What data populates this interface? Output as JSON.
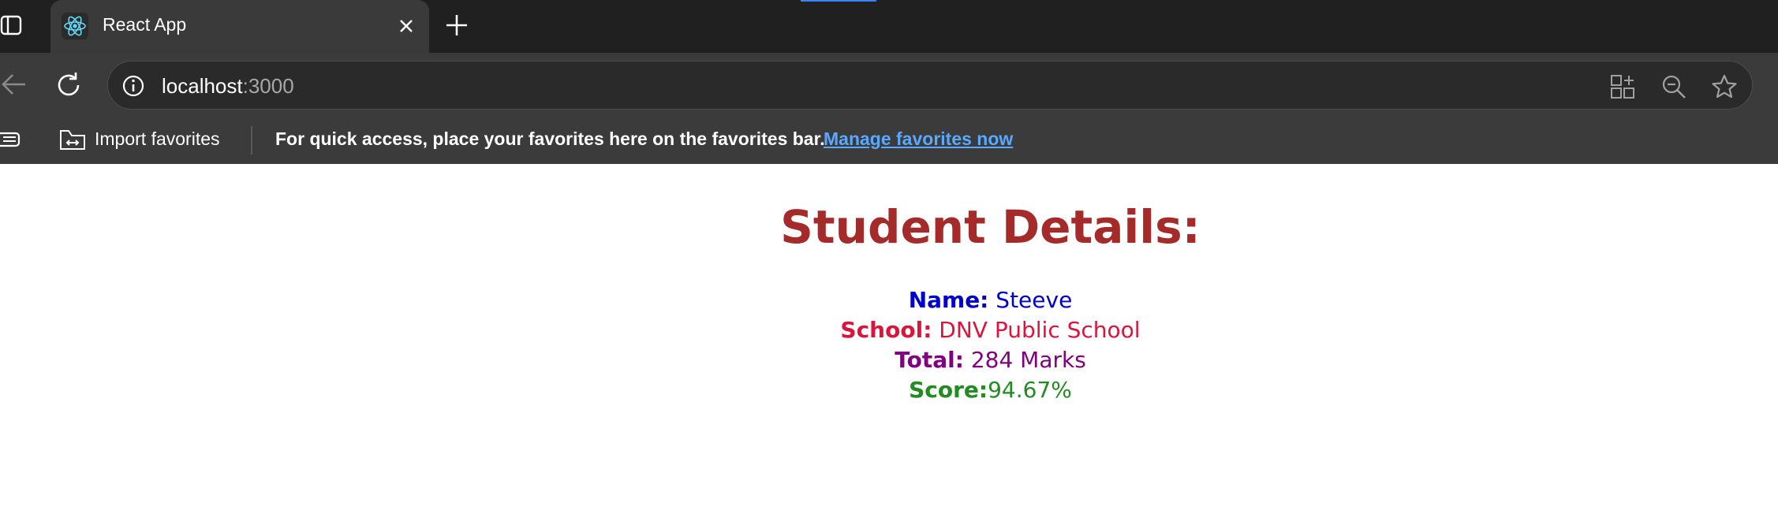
{
  "browser": {
    "tab": {
      "title": "React App"
    },
    "address": {
      "host": "localhost",
      "port": ":3000"
    },
    "favorites_bar": {
      "import_label": "Import favorites",
      "message": "For quick access, place your favorites here on the favorites bar.",
      "link": "Manage favorites now"
    },
    "icons": [
      "tab-actions-icon",
      "react-favicon-icon",
      "close-icon",
      "plus-icon",
      "back-arrow-icon",
      "reload-icon",
      "info-icon",
      "apps-icon",
      "zoom-out-icon",
      "star-icon",
      "favorites-icon",
      "import-folder-icon"
    ],
    "colors": {
      "tabstrip": "#202020",
      "toolbar": "#3b3b3b",
      "link": "#5aa9ff"
    }
  },
  "page": {
    "title": "Student Details:",
    "details": {
      "name": {
        "label": "Name:",
        "value": "Steeve"
      },
      "school": {
        "label": "School:",
        "value": "DNV Public School"
      },
      "total": {
        "label": "Total:",
        "value": "284 Marks"
      },
      "score": {
        "label": "Score:",
        "value": "94.67%"
      }
    },
    "colors": {
      "title": "#a52a2a",
      "name": "#0000cd",
      "school": "#dc143c",
      "total": "#800080",
      "score": "#228b22"
    }
  }
}
